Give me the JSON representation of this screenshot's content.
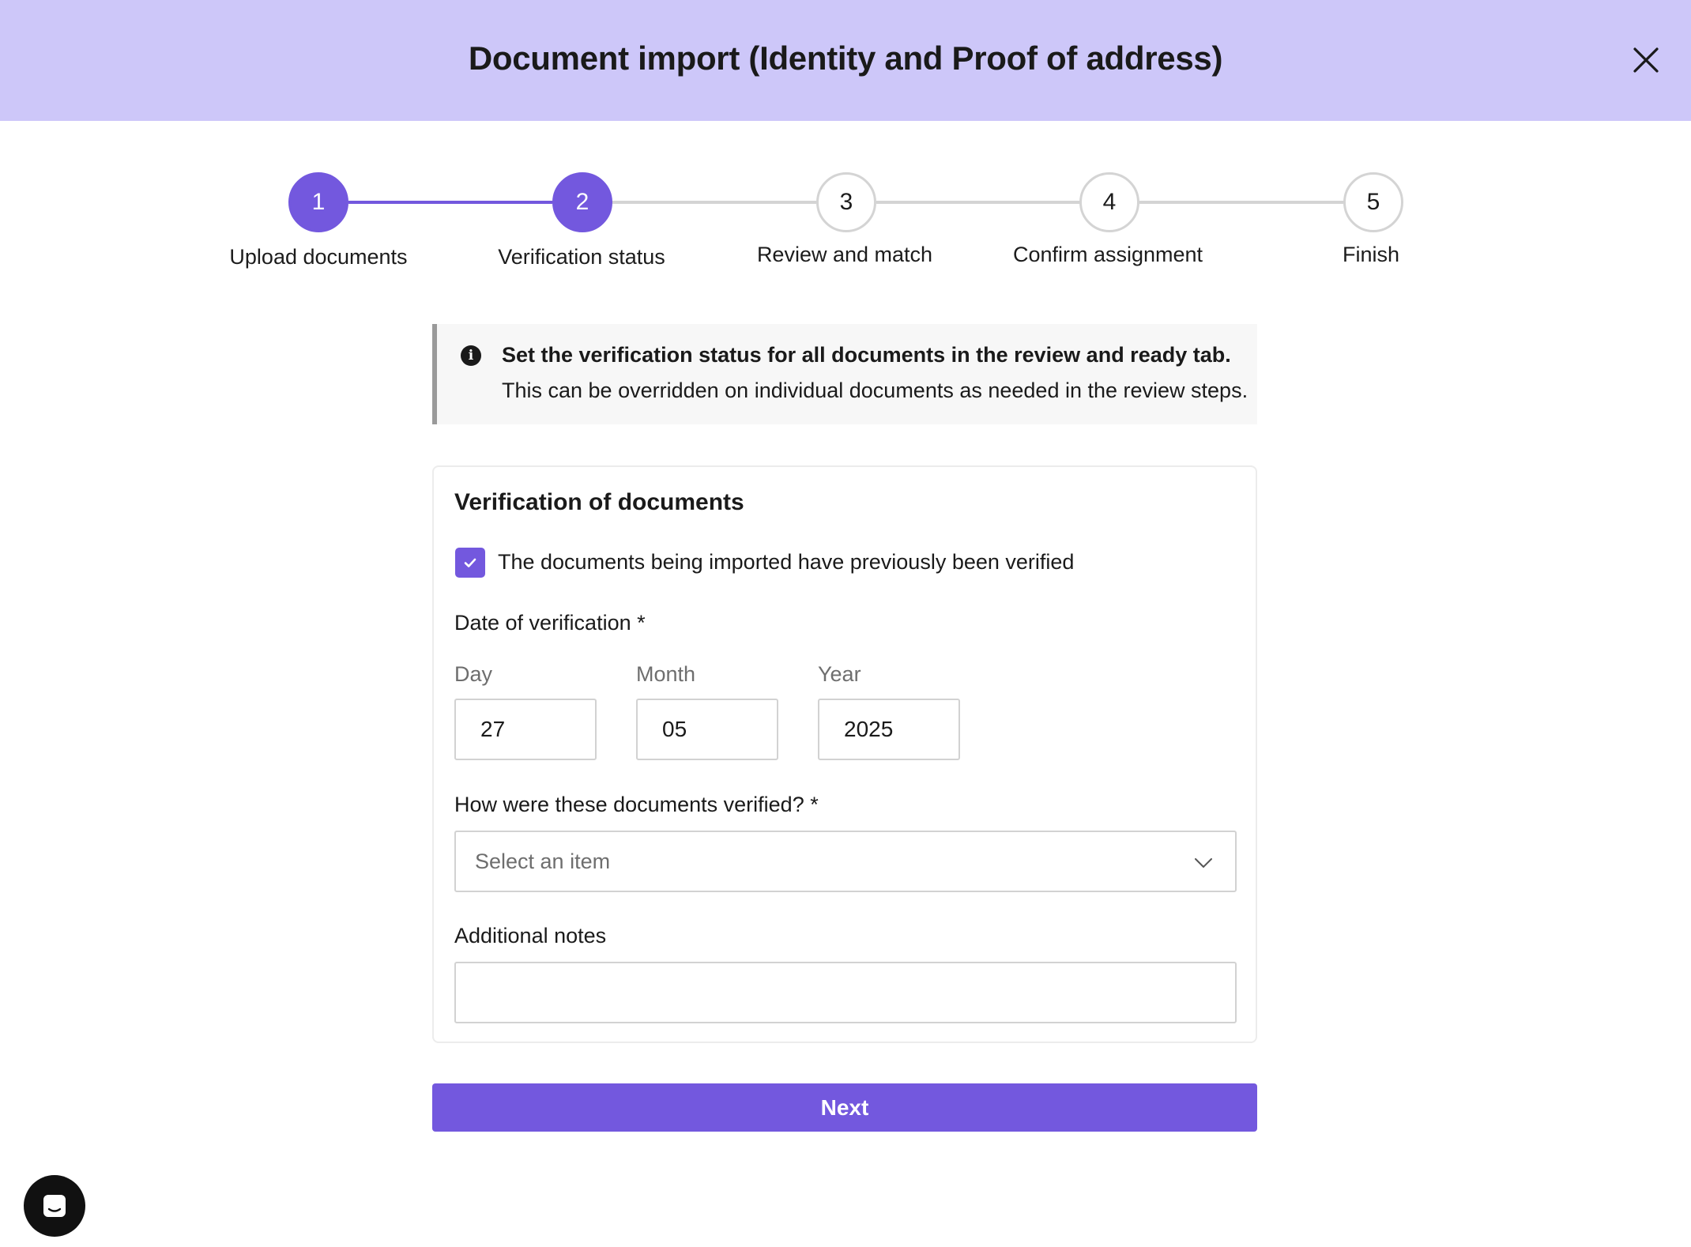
{
  "dialog": {
    "title": "Document import (Identity and Proof of address)",
    "close_icon": "close-icon"
  },
  "stepper": {
    "steps": [
      {
        "number": "1",
        "label": "Upload documents",
        "state": "completed"
      },
      {
        "number": "2",
        "label": "Verification status",
        "state": "current"
      },
      {
        "number": "3",
        "label": "Review and match",
        "state": "upcoming"
      },
      {
        "number": "4",
        "label": "Confirm assignment",
        "state": "upcoming"
      },
      {
        "number": "5",
        "label": "Finish",
        "state": "upcoming"
      }
    ]
  },
  "info_banner": {
    "icon": "info-icon",
    "icon_glyph": "i",
    "title": "Set the verification status for all documents in the review and ready tab.",
    "text": "This can be overridden on individual documents as needed in the review steps."
  },
  "verification": {
    "title": "Verification of documents",
    "previously_verified": {
      "checked": true,
      "label": "The documents being imported have previously been verified"
    },
    "date": {
      "label": "Date of verification *",
      "day_label": "Day",
      "day_value": "27",
      "month_label": "Month",
      "month_value": "05",
      "year_label": "Year",
      "year_value": "2025"
    },
    "method": {
      "label": "How were these documents verified? *",
      "placeholder": "Select an item"
    },
    "notes": {
      "label": "Additional notes",
      "value": ""
    }
  },
  "actions": {
    "next_label": "Next"
  },
  "colors": {
    "header_bg": "#cdc7f9",
    "accent": "#7358de",
    "inactive_step": "#d4d4d4"
  }
}
